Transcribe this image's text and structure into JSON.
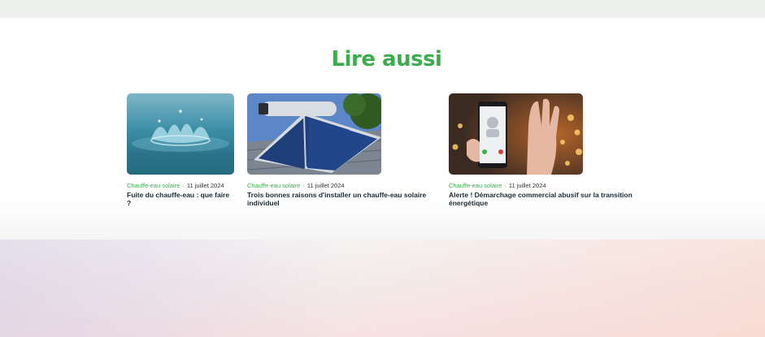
{
  "section": {
    "title": "Lire aussi"
  },
  "articles": [
    {
      "category": "Chauffe-eau solaire",
      "date": "11 juillet 2024",
      "title": "Fuite du chauffe-eau : que faire ?"
    },
    {
      "category": "Chauffe-eau solaire",
      "date": "11 juillet 2024",
      "title": "Trois bonnes raisons d'installer un chauffe-eau solaire individuel"
    },
    {
      "category": "Chauffe-eau solaire",
      "date": "11 juillet 2024",
      "title": "Alerte ! Démarchage commercial abusif sur la transition énergétique"
    }
  ],
  "separator": "·",
  "colors": {
    "accent": "#3aad4c",
    "title_text": "#1c2b35"
  }
}
